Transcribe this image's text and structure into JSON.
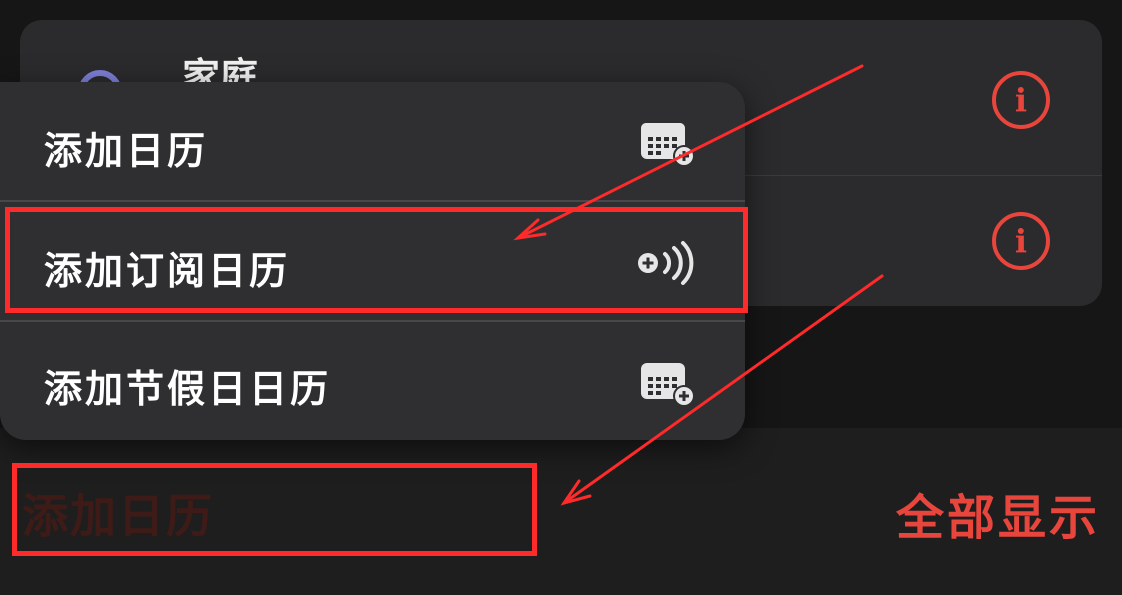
{
  "calendar_list": {
    "row_title": "家庭"
  },
  "menu": {
    "items": [
      {
        "label": "添加日历",
        "icon": "calendar-add-icon"
      },
      {
        "label": "添加订阅日历",
        "icon": "subscribe-broadcast-icon"
      },
      {
        "label": "添加节假日日历",
        "icon": "calendar-add-icon"
      }
    ]
  },
  "toolbar": {
    "add_label": "添加日历",
    "show_all_label": "全部显示"
  },
  "colors": {
    "accent": "#e8453c",
    "annotation": "#ff2a2a",
    "calendar_dot": "#7d7fd6"
  }
}
